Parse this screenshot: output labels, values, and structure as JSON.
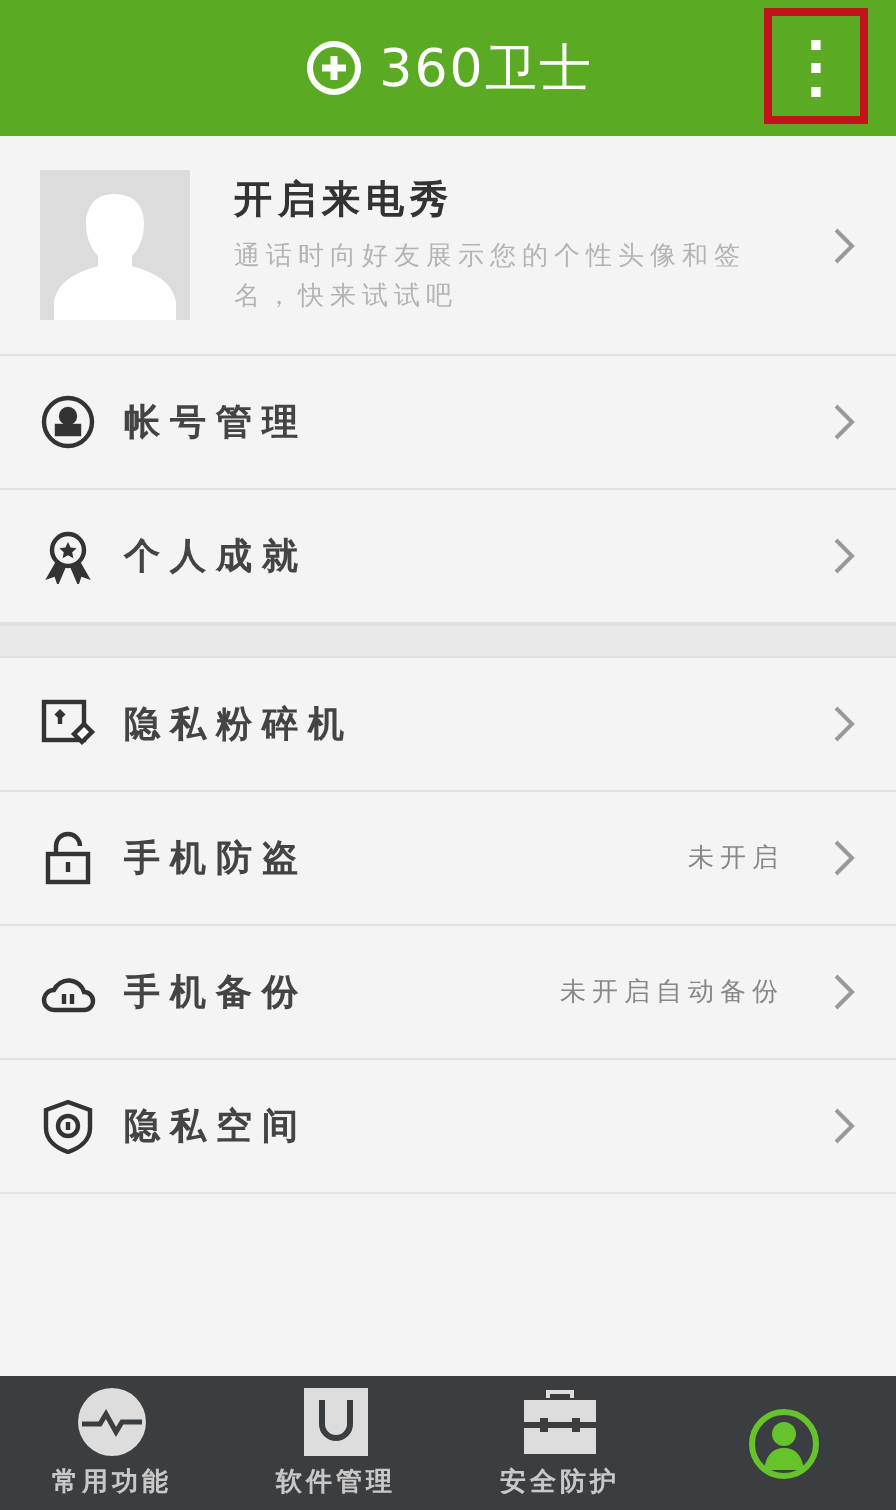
{
  "header": {
    "logo_text": "360卫士",
    "menu_button": {
      "glyph": "⋮",
      "highlighted": true
    }
  },
  "profile": {
    "title": "开启来电秀",
    "subtitle": "通话时向好友展示您的个性头像和签名，快来试试吧"
  },
  "groups": [
    {
      "items": [
        {
          "kind": "account",
          "label": "帐号管理"
        },
        {
          "kind": "medal",
          "label": "个人成就"
        }
      ]
    },
    {
      "items": [
        {
          "kind": "shredder",
          "label": "隐私粉碎机"
        },
        {
          "kind": "lock",
          "label": "手机防盗",
          "status": "未开启"
        },
        {
          "kind": "cloud",
          "label": "手机备份",
          "status": "未开启自动备份"
        },
        {
          "kind": "shield",
          "label": "隐私空间"
        }
      ]
    }
  ],
  "tab_bar": [
    {
      "kind": "pulse",
      "label": "常用功能",
      "selected": false
    },
    {
      "kind": "bag",
      "label": "软件管理",
      "selected": false
    },
    {
      "kind": "toolbox",
      "label": "安全防护",
      "selected": false
    },
    {
      "kind": "person",
      "selected": true
    }
  ]
}
